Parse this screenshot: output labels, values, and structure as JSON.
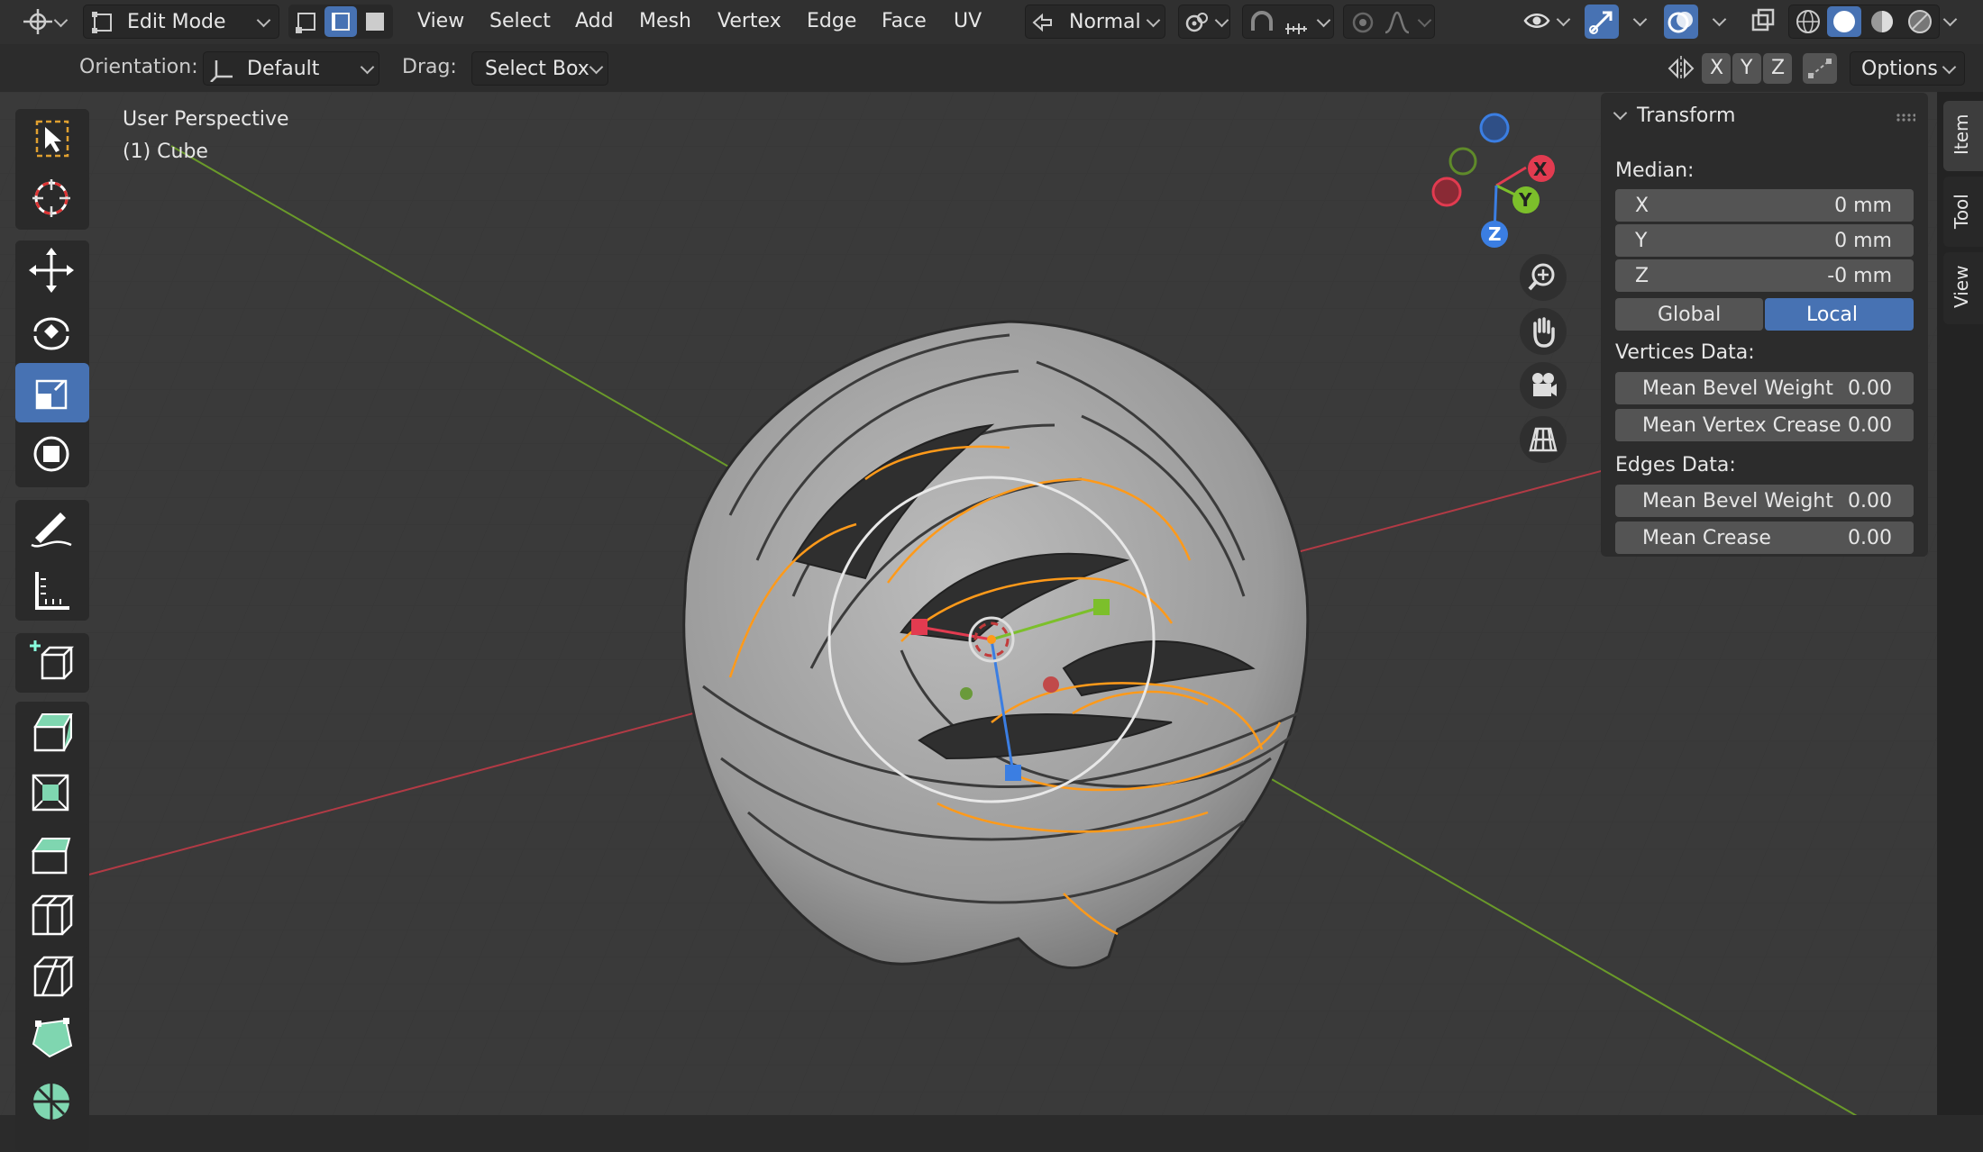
{
  "header": {
    "mode": "Edit Mode",
    "menu": [
      "View",
      "Select",
      "Add",
      "Mesh",
      "Vertex",
      "Edge",
      "Face",
      "UV"
    ],
    "transform_orientation": "Normal",
    "options_label": "Options",
    "axis_x": "X",
    "axis_y": "Y",
    "axis_z": "Z"
  },
  "tool_header": {
    "orientation_label": "Orientation:",
    "orientation_value": "Default",
    "drag_label": "Drag:",
    "drag_value": "Select Box"
  },
  "viewport": {
    "view_name": "User Perspective",
    "object_name": "(1) Cube"
  },
  "gizmo": {
    "x": "X",
    "y": "Y",
    "z": "Z"
  },
  "sidebar": {
    "tabs": [
      "Item",
      "Tool",
      "View"
    ],
    "transform": {
      "title": "Transform",
      "median_label": "Median:",
      "x": {
        "label": "X",
        "value": "0 mm"
      },
      "y": {
        "label": "Y",
        "value": "0 mm"
      },
      "z": {
        "label": "Z",
        "value": "-0 mm"
      },
      "global_label": "Global",
      "local_label": "Local",
      "vertices_label": "Vertices Data:",
      "v_bevel": {
        "label": "Mean Bevel Weight",
        "value": "0.00"
      },
      "v_crease": {
        "label": "Mean Vertex Crease",
        "value": "0.00"
      },
      "edges_label": "Edges Data:",
      "e_bevel": {
        "label": "Mean Bevel Weight",
        "value": "0.00"
      },
      "e_crease": {
        "label": "Mean Crease",
        "value": "0.00"
      }
    }
  },
  "colors": {
    "accent": "#4772b3",
    "selection": "#ff9a1a",
    "axis_x": "#e23b50",
    "axis_y": "#7cbf2b",
    "axis_z": "#3b7ee2"
  }
}
